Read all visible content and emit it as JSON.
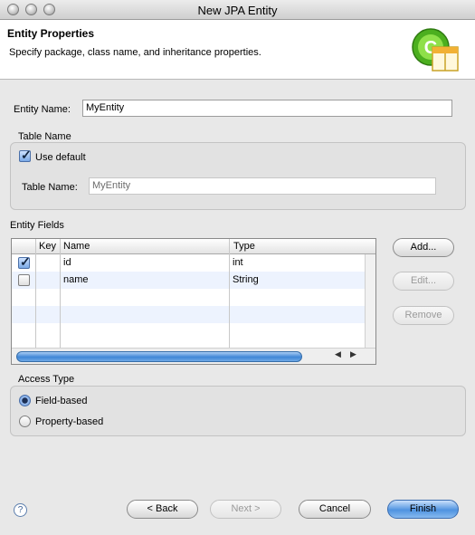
{
  "window": {
    "title": "New JPA Entity"
  },
  "banner": {
    "title": "Entity Properties",
    "description": "Specify package, class name, and inheritance properties.",
    "icon": "class-wizard-icon"
  },
  "entity_name": {
    "label": "Entity Name:",
    "value": "MyEntity"
  },
  "table_name_group": {
    "title": "Table Name",
    "use_default_label": "Use default",
    "use_default_checked": true,
    "table_name_label": "Table Name:",
    "table_name_value": "MyEntity"
  },
  "entity_fields": {
    "title": "Entity Fields",
    "columns": [
      "",
      "Key",
      "Name",
      "Type"
    ],
    "rows": [
      {
        "checked": true,
        "key": "",
        "name": "id",
        "type": "int"
      },
      {
        "checked": false,
        "key": "",
        "name": "name",
        "type": "String"
      }
    ],
    "buttons": {
      "add": "Add...",
      "edit": "Edit...",
      "remove": "Remove"
    }
  },
  "access_type": {
    "title": "Access Type",
    "options": [
      {
        "label": "Field-based",
        "selected": true
      },
      {
        "label": "Property-based",
        "selected": false
      }
    ]
  },
  "footer": {
    "help": "?",
    "back": "< Back",
    "next": "Next >",
    "cancel": "Cancel",
    "finish": "Finish"
  },
  "colors": {
    "accent": "#4f93e0",
    "row_alt": "#edf3fe"
  }
}
